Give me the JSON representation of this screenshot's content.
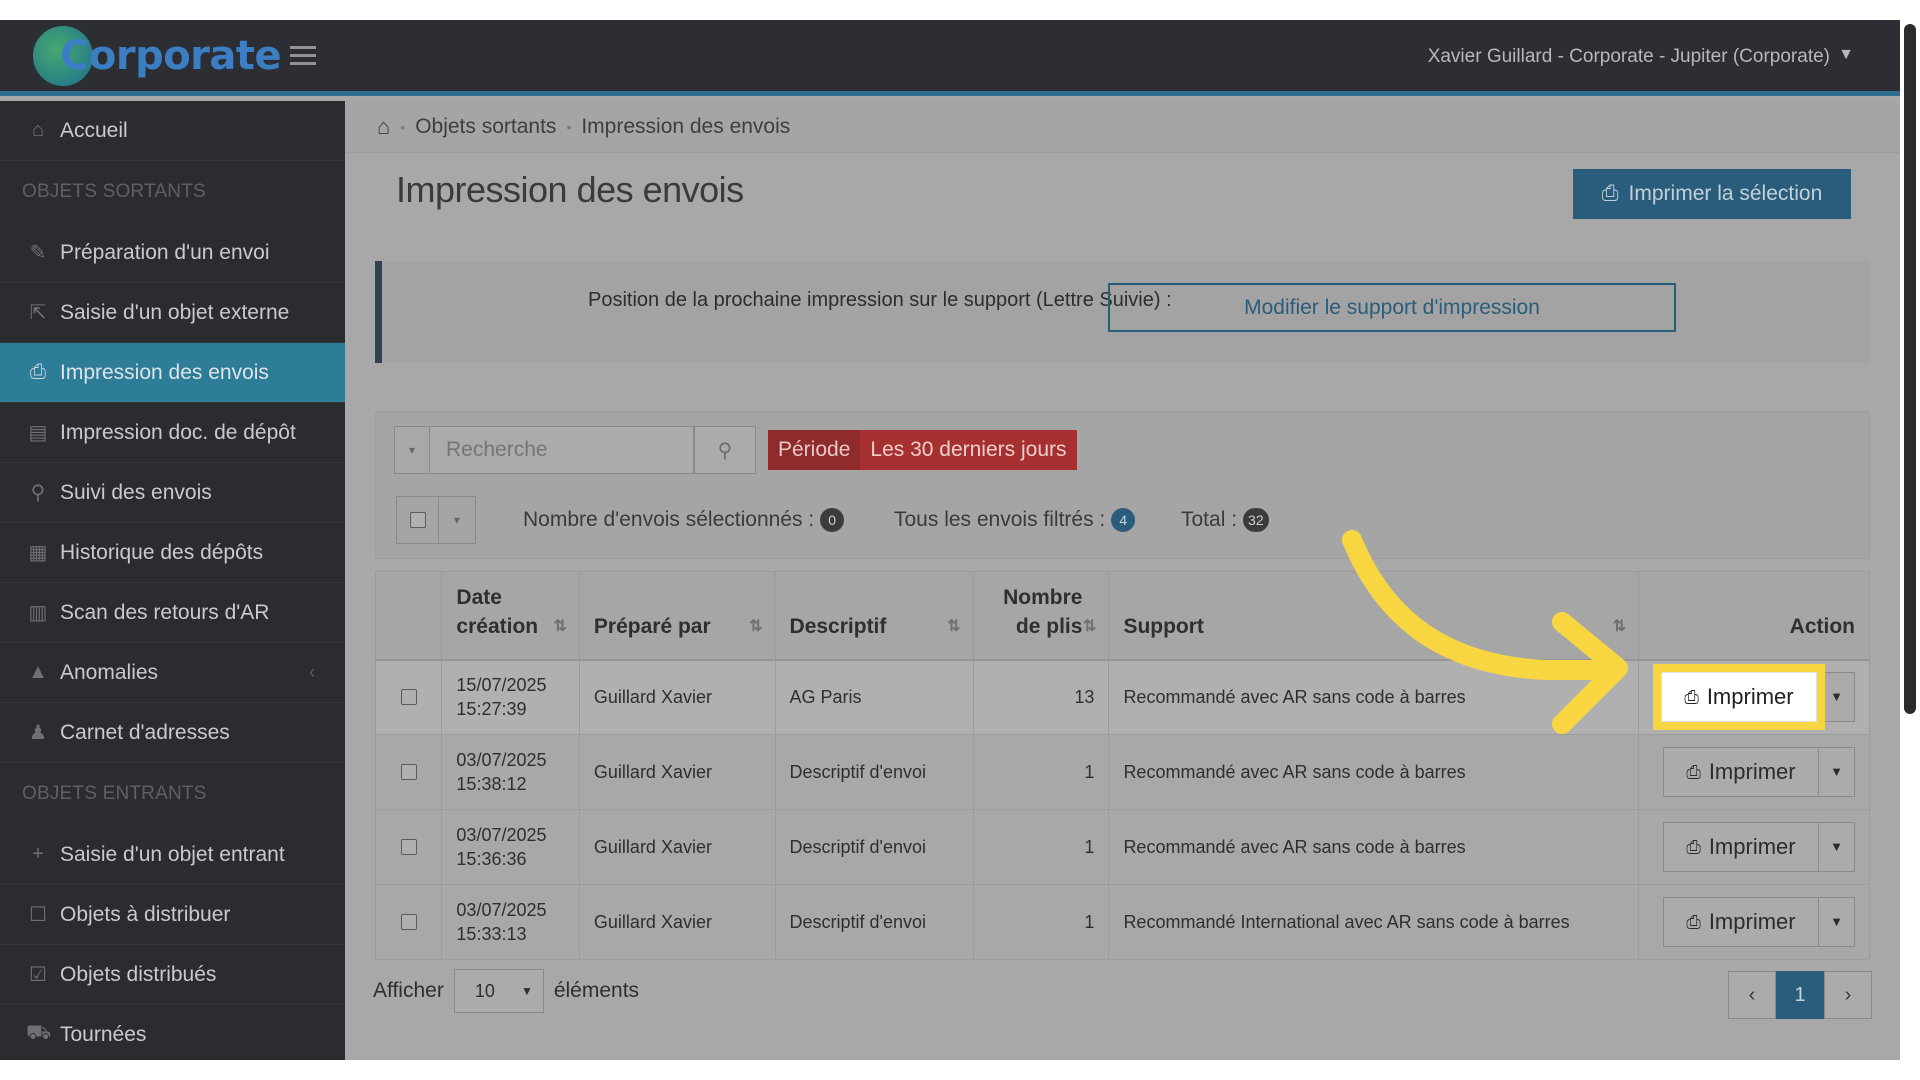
{
  "header": {
    "logo_text": "Corporate",
    "user": "Xavier Guillard - Corporate - Jupiter (Corporate)"
  },
  "sidebar": {
    "home": "Accueil",
    "section_out": "OBJETS SORTANTS",
    "items_out": [
      {
        "label": "Préparation d'un envoi",
        "icon": "pencil-icon",
        "glyph": "✎"
      },
      {
        "label": "Saisie d'un objet externe",
        "icon": "external-edit-icon",
        "glyph": "⇱"
      },
      {
        "label": "Impression des envois",
        "icon": "printer-icon",
        "glyph": "⎙"
      },
      {
        "label": "Impression doc. de dépôt",
        "icon": "document-icon",
        "glyph": "▤"
      },
      {
        "label": "Suivi des envois",
        "icon": "search-icon",
        "glyph": "⚲"
      },
      {
        "label": "Historique des dépôts",
        "icon": "calendar-icon",
        "glyph": "▦"
      },
      {
        "label": "Scan des retours d'AR",
        "icon": "barcode-icon",
        "glyph": "▥"
      },
      {
        "label": "Anomalies",
        "icon": "warning-icon",
        "glyph": "▲"
      },
      {
        "label": "Carnet d'adresses",
        "icon": "users-icon",
        "glyph": "♟"
      }
    ],
    "section_in": "OBJETS ENTRANTS",
    "items_in": [
      {
        "label": "Saisie d'un objet entrant",
        "icon": "plus-icon",
        "glyph": "+"
      },
      {
        "label": "Objets à distribuer",
        "icon": "square-icon",
        "glyph": "☐"
      },
      {
        "label": "Objets distribués",
        "icon": "checked-square-icon",
        "glyph": "☑"
      },
      {
        "label": "Tournées",
        "icon": "cart-icon",
        "glyph": "⛟"
      }
    ]
  },
  "breadcrumb": {
    "level1": "Objets sortants",
    "level2": "Impression des envois"
  },
  "page": {
    "title": "Impression des envois",
    "print_selection": "Imprimer la sélection",
    "info_text": "Position de la prochaine impression sur le support (Lettre Suivie) :",
    "modify_support": "Modifier le support d'impression"
  },
  "filters": {
    "search_placeholder": "Recherche",
    "period_label": "Période",
    "period_value": "Les 30 derniers jours",
    "selected_label": "Nombre d'envois sélectionnés :",
    "selected_count": "0",
    "filtered_label": "Tous les envois filtrés :",
    "filtered_count": "4",
    "total_label": "Total :",
    "total_count": "32"
  },
  "table": {
    "headers": {
      "date": "Date création",
      "prepared_by": "Préparé par",
      "description": "Descriptif",
      "count": "Nombre de plis",
      "support": "Support",
      "action": "Action"
    },
    "action_label": "Imprimer",
    "rows": [
      {
        "date": "15/07/2025",
        "time": "15:27:39",
        "prepared_by": "Guillard Xavier",
        "description": "AG Paris",
        "count": "13",
        "support": "Recommandé avec AR sans code à barres"
      },
      {
        "date": "03/07/2025",
        "time": "15:38:12",
        "prepared_by": "Guillard Xavier",
        "description": "Descriptif d'envoi",
        "count": "1",
        "support": "Recommandé avec AR sans code à barres"
      },
      {
        "date": "03/07/2025",
        "time": "15:36:36",
        "prepared_by": "Guillard Xavier",
        "description": "Descriptif d'envoi",
        "count": "1",
        "support": "Recommandé avec AR sans code à barres"
      },
      {
        "date": "03/07/2025",
        "time": "15:33:13",
        "prepared_by": "Guillard Xavier",
        "description": "Descriptif d'envoi",
        "count": "1",
        "support": "Recommandé International avec AR sans code à barres"
      }
    ]
  },
  "footer": {
    "show_label": "Afficher",
    "page_length": "10",
    "elements_label": "éléments",
    "current_page": "1"
  },
  "colors": {
    "highlight": "#f8d642",
    "accent": "#2a5d7c"
  }
}
